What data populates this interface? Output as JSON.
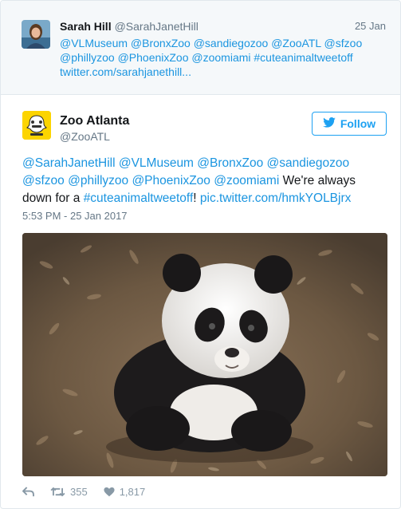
{
  "reply": {
    "name": "Sarah Hill",
    "handle": "@SarahJanetHill",
    "date": "25 Jan",
    "text": "@VLMuseum @BronxZoo @sandiegozoo @ZooATL @sfzoo @phillyzoo @PhoenixZoo @zoomiami #cuteanimaltweetoff twitter.com/sarahjanethill..."
  },
  "tweet": {
    "name": "Zoo Atlanta",
    "handle": "@ZooATL",
    "follow_label": "Follow",
    "mentions": "@SarahJanetHill @VLMuseum @BronxZoo @sandiegozoo @sfzoo @phillyzoo @PhoenixZoo @zoomiami",
    "text_mid": " We're always down for a ",
    "hashtag": "#cuteanimaltweetoff",
    "text_end": "! ",
    "pic_link": "pic.twitter.com/hmkYOLBjrx",
    "timestamp": "5:53 PM - 25 Jan 2017",
    "retweets": "355",
    "likes": "1,817"
  },
  "colors": {
    "link": "#1b95e0",
    "follow": "#1da1f2",
    "meta": "#657786"
  },
  "icons": [
    "twitter-bird-icon",
    "reply-icon",
    "retweet-icon",
    "heart-icon"
  ]
}
